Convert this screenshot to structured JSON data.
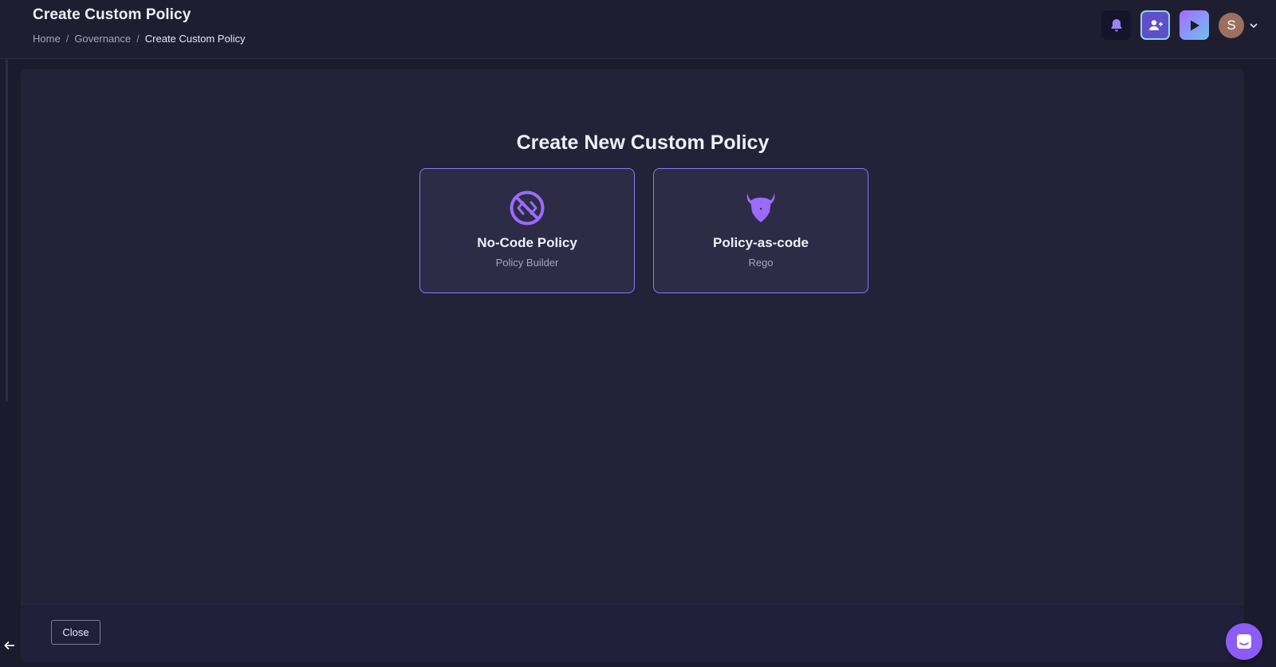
{
  "header": {
    "title": "Create Custom Policy",
    "breadcrumb": [
      "Home",
      "Governance",
      "Create Custom Policy"
    ],
    "breadcrumb_separator": "/",
    "avatar_initial": "S",
    "icons": {
      "notifications": "bell-icon",
      "invite": "user-plus-icon",
      "play": "play-icon",
      "dropdown": "chevron-down-icon"
    }
  },
  "main": {
    "title": "Create New Custom Policy",
    "options": [
      {
        "title": "No-Code Policy",
        "subtitle": "Policy Builder",
        "icon": "no-code-icon"
      },
      {
        "title": "Policy-as-code",
        "subtitle": "Rego",
        "icon": "opa-icon"
      }
    ]
  },
  "footer": {
    "close_label": "Close"
  },
  "colors": {
    "accent": "#8b5cf6",
    "card_border": "#8a78f0",
    "background": "#1c1b2e",
    "panel": "#232238"
  }
}
